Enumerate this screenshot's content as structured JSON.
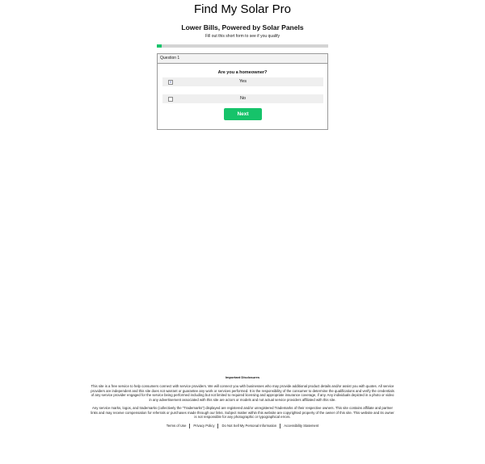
{
  "brand": {
    "title": "Find My Solar Pro"
  },
  "hero": {
    "headline": "Lower Bills, Powered by Solar Panels",
    "subline": "Fill out this short form to see if you qualify"
  },
  "progress": {
    "fraction": 0.03,
    "fill_color": "#19c46b",
    "track_color": "#d4d4d4"
  },
  "form": {
    "step_label": "Question 1",
    "question": "Are you a homeowner?",
    "options": [
      {
        "label": "Yes",
        "icon": "checkbox-icon",
        "mark": "✕"
      },
      {
        "label": "No",
        "icon": "checkbox-icon",
        "mark": ""
      }
    ],
    "next_label": "Next",
    "accent_color": "#16c36a"
  },
  "disclosures": {
    "title": "Important Disclosures",
    "paragraph1": "This site is a free service to help consumers connect with service providers. We will connect you with businesses who may provide additional product details and/or assist you with quotes. All service providers are independent and this site does not warrant or guarantee any work or services performed. It is the responsibility of the consumer to determine the qualifications and verify the credentials of any service provider engaged for the service being performed including but not limited to required licensing and appropriate insurance coverage, if any. Any individuals depicted in a photo or video in any advertisement associated with this site are actors or models and not actual service providers affiliated with this site.",
    "paragraph2": "Any service marks, logos, and trademarks (collectively the \"Trademarks\") displayed are registered and/or unregistered Trademarks of their respective owners. This site contains affiliate and partner links and may receive compensation for referrals or purchases made through our links. Subject matter within this website are copyrighted property of the owner of this site. This website and its owner is not responsible for any photographic or typographical errors."
  },
  "footer": {
    "links": [
      "Terms of Use",
      "Privacy Policy",
      "Do Not Sell My Personal Information",
      "Accessibility Statement"
    ]
  }
}
